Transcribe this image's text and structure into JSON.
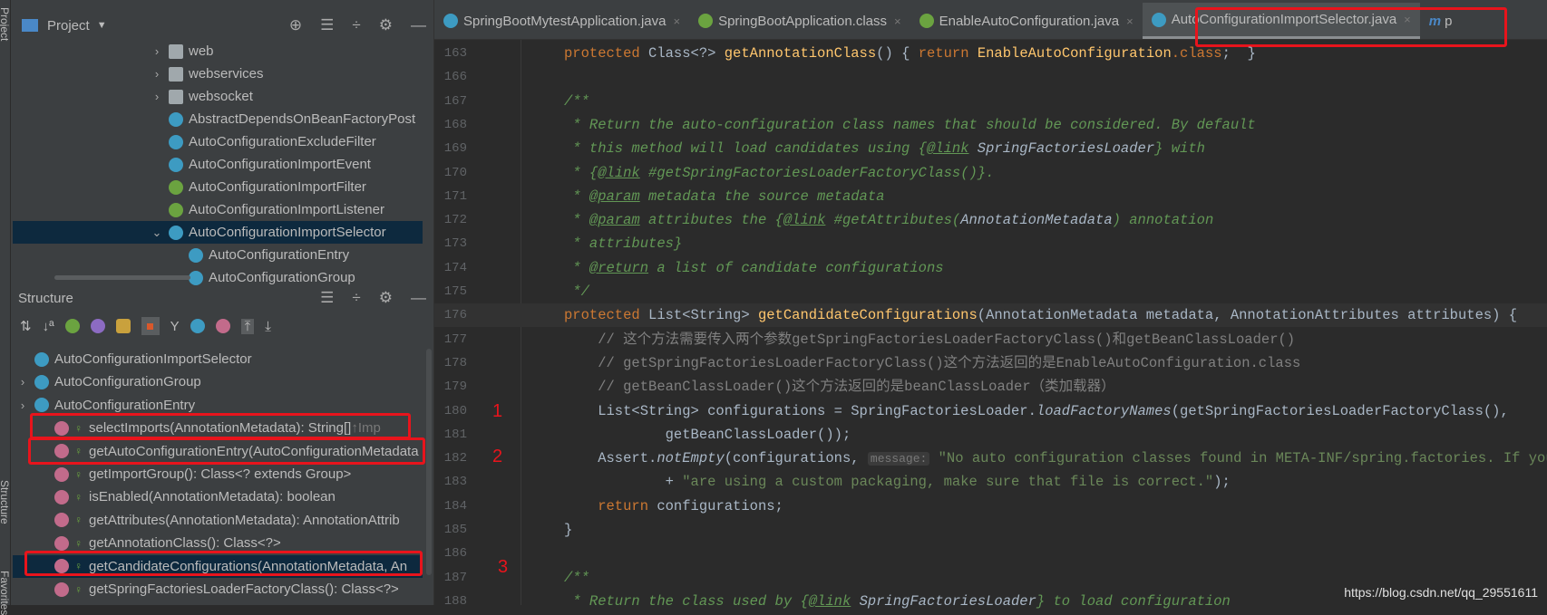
{
  "side_strip": {
    "project": "Project",
    "structure": "Structure",
    "favorites": "Favorites"
  },
  "project": {
    "title": "Project",
    "items": [
      {
        "label": "web",
        "icon": "folder",
        "chev": ">",
        "indent": 1
      },
      {
        "label": "webservices",
        "icon": "folder",
        "chev": ">",
        "indent": 1
      },
      {
        "label": "websocket",
        "icon": "folder",
        "chev": ">",
        "indent": 1
      },
      {
        "label": "AbstractDependsOnBeanFactoryPost",
        "icon": "abstract-class",
        "chev": "",
        "indent": 1
      },
      {
        "label": "AutoConfigurationExcludeFilter",
        "icon": "class",
        "chev": "",
        "indent": 1
      },
      {
        "label": "AutoConfigurationImportEvent",
        "icon": "class",
        "chev": "",
        "indent": 1
      },
      {
        "label": "AutoConfigurationImportFilter",
        "icon": "interface",
        "chev": "",
        "indent": 1
      },
      {
        "label": "AutoConfigurationImportListener",
        "icon": "interface",
        "chev": "",
        "indent": 1
      },
      {
        "label": "AutoConfigurationImportSelector",
        "icon": "class",
        "chev": "v",
        "indent": 1,
        "selected": true
      },
      {
        "label": "AutoConfigurationEntry",
        "icon": "class",
        "chev": "",
        "indent": 2
      },
      {
        "label": "AutoConfigurationGroup",
        "icon": "class",
        "chev": "",
        "indent": 2
      }
    ]
  },
  "structure": {
    "title": "Structure",
    "items": [
      {
        "label": "AutoConfigurationImportSelector",
        "icon": "class",
        "chev": "",
        "indent": 0
      },
      {
        "label": "AutoConfigurationGroup",
        "icon": "class",
        "chev": ">",
        "indent": 0
      },
      {
        "label": "AutoConfigurationEntry",
        "icon": "class",
        "chev": ">",
        "indent": 0
      },
      {
        "label": "selectImports(AnnotationMetadata): String[]",
        "suffix": " ↑Imp",
        "icon": "method",
        "indent": 1
      },
      {
        "label": "getAutoConfigurationEntry(AutoConfigurationMetadata",
        "icon": "method",
        "indent": 1
      },
      {
        "label": "getImportGroup(): Class<? extends Group>",
        "icon": "method",
        "indent": 1
      },
      {
        "label": "isEnabled(AnnotationMetadata): boolean",
        "icon": "method",
        "indent": 1
      },
      {
        "label": "getAttributes(AnnotationMetadata): AnnotationAttrib",
        "icon": "method",
        "indent": 1
      },
      {
        "label": "getAnnotationClass(): Class<?>",
        "icon": "method",
        "indent": 1
      },
      {
        "label": "getCandidateConfigurations(AnnotationMetadata, An",
        "icon": "method",
        "indent": 1,
        "selected": true
      },
      {
        "label": "getSpringFactoriesLoaderFactoryClass(): Class<?>",
        "icon": "method",
        "indent": 1
      }
    ]
  },
  "tabs": [
    {
      "label": "SpringBootMytestApplication.java"
    },
    {
      "label": "SpringBootApplication.class"
    },
    {
      "label": "EnableAutoConfiguration.java"
    },
    {
      "label": "AutoConfigurationImportSelector.java",
      "active": true
    },
    {
      "label": "p"
    }
  ],
  "code": [
    {
      "n": "163",
      "t": [
        [
          "kw",
          "protected "
        ],
        [
          "",
          "Class<?> "
        ],
        [
          "fn",
          "getAnnotationClass"
        ],
        [
          "",
          "() { "
        ],
        [
          "kw",
          "return "
        ],
        [
          "fn",
          "EnableAutoConfiguration"
        ],
        [
          "kw",
          ".class"
        ],
        [
          "",
          ";  }"
        ]
      ]
    },
    {
      "n": "166",
      "t": []
    },
    {
      "n": "167",
      "t": [
        [
          "doc",
          "/**"
        ]
      ]
    },
    {
      "n": "168",
      "t": [
        [
          "doc",
          " * Return the auto-configuration class names that should be considered. By default"
        ]
      ]
    },
    {
      "n": "169",
      "t": [
        [
          "doc",
          " * this method will load candidates using {"
        ],
        [
          "tag",
          "@link"
        ],
        [
          "docref",
          " SpringFactoriesLoader"
        ],
        [
          "doc",
          "} with"
        ]
      ]
    },
    {
      "n": "170",
      "t": [
        [
          "doc",
          " * {"
        ],
        [
          "tag",
          "@link"
        ],
        [
          "doc",
          " #getSpringFactoriesLoaderFactoryClass()}."
        ]
      ]
    },
    {
      "n": "171",
      "t": [
        [
          "doc",
          " * "
        ],
        [
          "tag",
          "@param"
        ],
        [
          "doc",
          " metadata the source metadata"
        ]
      ]
    },
    {
      "n": "172",
      "t": [
        [
          "doc",
          " * "
        ],
        [
          "tag",
          "@param"
        ],
        [
          "doc",
          " attributes the {"
        ],
        [
          "tag",
          "@link"
        ],
        [
          "doc",
          " #getAttributes("
        ],
        [
          "docref",
          "AnnotationMetadata"
        ],
        [
          "doc",
          ") annotation"
        ]
      ]
    },
    {
      "n": "173",
      "t": [
        [
          "doc",
          " * attributes}"
        ]
      ]
    },
    {
      "n": "174",
      "t": [
        [
          "doc",
          " * "
        ],
        [
          "tag",
          "@return"
        ],
        [
          "doc",
          " a list of candidate configurations"
        ]
      ]
    },
    {
      "n": "175",
      "t": [
        [
          "doc",
          " */"
        ]
      ]
    },
    {
      "n": "176",
      "cur": true,
      "t": [
        [
          "kw",
          "protected "
        ],
        [
          "",
          "List<String> "
        ],
        [
          "fn",
          "getCandidateConfigurations"
        ],
        [
          "",
          "(AnnotationMetadata metadata, AnnotationAttributes attributes) {"
        ]
      ]
    },
    {
      "n": "177",
      "t": [
        [
          "cm",
          "    // 这个方法需要传入两个参数getSpringFactoriesLoaderFactoryClass()和getBeanClassLoader()"
        ]
      ]
    },
    {
      "n": "178",
      "t": [
        [
          "cm",
          "    // getSpringFactoriesLoaderFactoryClass()这个方法返回的是EnableAutoConfiguration.class"
        ]
      ]
    },
    {
      "n": "179",
      "t": [
        [
          "cm",
          "    // getBeanClassLoader()这个方法返回的是beanClassLoader（类加载器）"
        ]
      ]
    },
    {
      "n": "180",
      "t": [
        [
          "",
          "    List<String> configurations = SpringFactoriesLoader."
        ],
        [
          "it",
          "loadFactoryNames"
        ],
        [
          "",
          "(getSpringFactoriesLoaderFactoryClass(),"
        ]
      ]
    },
    {
      "n": "181",
      "t": [
        [
          "",
          "            getBeanClassLoader());"
        ]
      ]
    },
    {
      "n": "182",
      "t": [
        [
          "",
          "    Assert."
        ],
        [
          "it",
          "notEmpty"
        ],
        [
          "",
          "(configurations, "
        ],
        [
          "hint",
          "message:"
        ],
        [
          "str",
          " \"No auto configuration classes found in META-INF/spring.factories. If you\""
        ]
      ]
    },
    {
      "n": "183",
      "t": [
        [
          "",
          "            + "
        ],
        [
          "str",
          "\"are using a custom packaging, make sure that file is correct.\""
        ],
        [
          "",
          ");"
        ]
      ]
    },
    {
      "n": "184",
      "t": [
        [
          "kw",
          "    return "
        ],
        [
          "",
          "configurations;"
        ]
      ]
    },
    {
      "n": "185",
      "t": [
        [
          "",
          "}"
        ]
      ]
    },
    {
      "n": "186",
      "t": []
    },
    {
      "n": "187",
      "t": [
        [
          "doc",
          "/**"
        ]
      ]
    },
    {
      "n": "188",
      "t": [
        [
          "doc",
          " * Return the class used by {"
        ],
        [
          "tag",
          "@link"
        ],
        [
          "docref",
          " SpringFactoriesLoader"
        ],
        [
          "doc",
          "} to load configuration"
        ]
      ]
    }
  ],
  "annotations": [
    "1",
    "2",
    "3"
  ],
  "watermark": "https://blog.csdn.net/qq_29551611",
  "colors": {
    "highlight": "#e8141c",
    "selection": "#0d293e"
  }
}
